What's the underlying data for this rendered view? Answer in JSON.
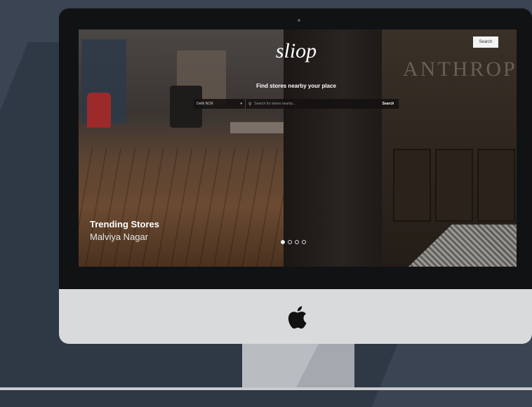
{
  "hero": {
    "logo": "sliop",
    "tagline": "Find stores nearby your place",
    "top_button": "Search",
    "store_sign": "ANTHROP"
  },
  "search": {
    "city": "Delhi NCR",
    "placeholder": "Search for stores nearby...",
    "submit": "Search"
  },
  "trending": {
    "title": "Trending Stores",
    "location": "Malviya Nagar"
  },
  "carousel": {
    "slides": 4,
    "active": 1
  },
  "icons": [
    "search-icon",
    "chevron-down-icon",
    "apple-logo-icon"
  ]
}
